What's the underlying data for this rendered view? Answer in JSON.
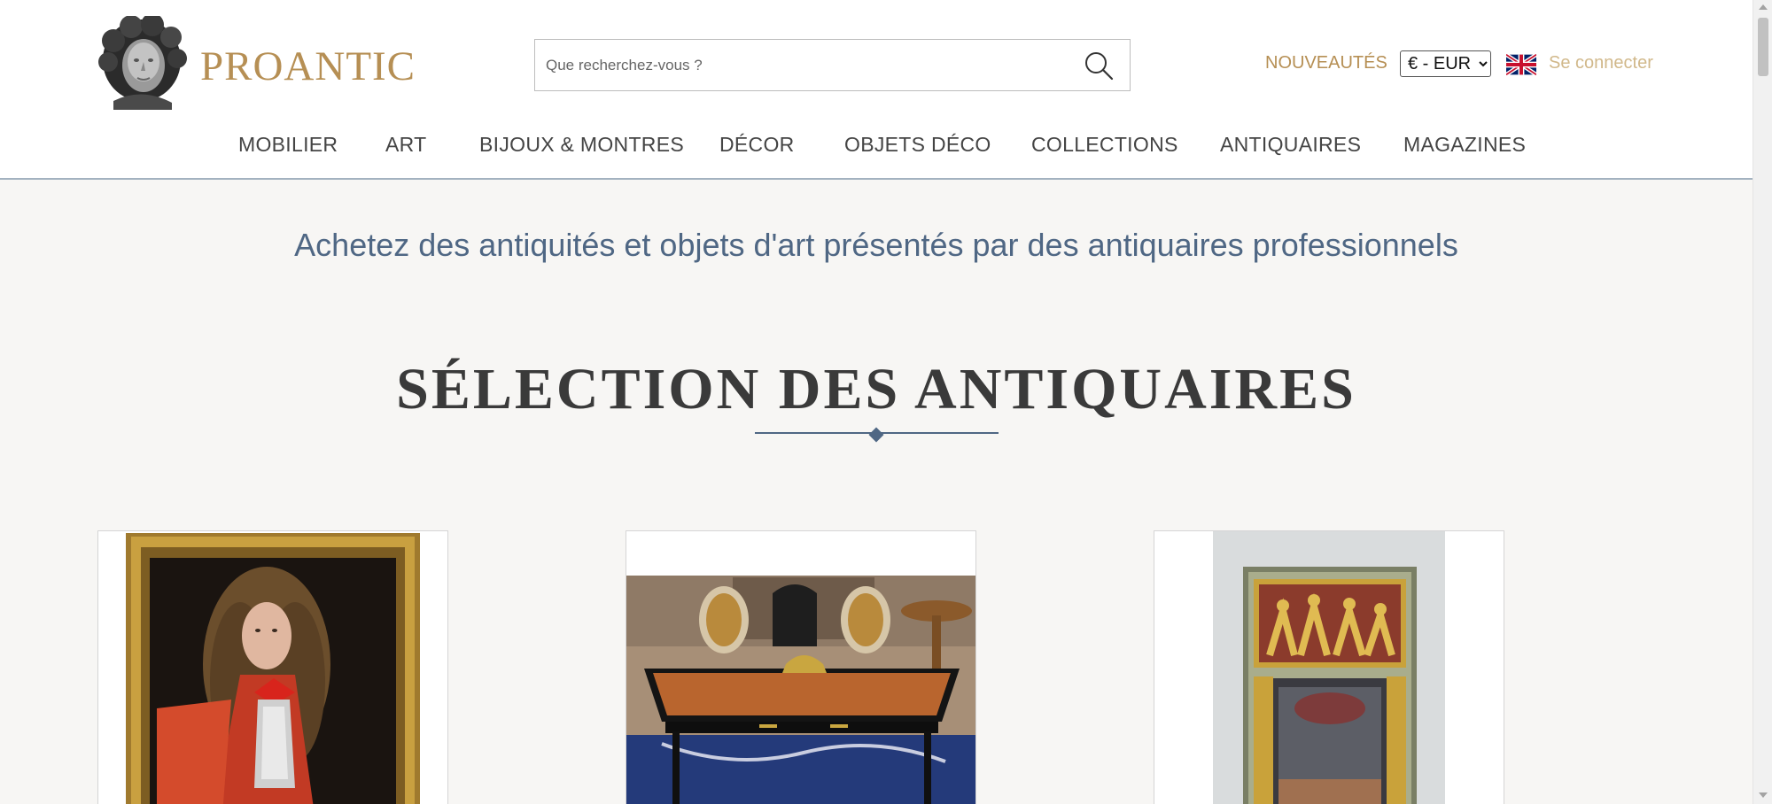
{
  "header": {
    "logo_text": "PROANTIC",
    "search": {
      "placeholder": "Que recherchez-vous ?",
      "value": ""
    },
    "nouveautes_label": "NOUVEAUTÉS",
    "currency": {
      "selected": "€ - EUR",
      "options": [
        "€ - EUR"
      ]
    },
    "language_flag": "uk-flag-icon",
    "login_label": "Se connecter"
  },
  "nav": {
    "items": [
      {
        "label": "MOBILIER"
      },
      {
        "label": "ART"
      },
      {
        "label": "BIJOUX & MONTRES"
      },
      {
        "label": "DÉCOR"
      },
      {
        "label": "OBJETS DÉCO"
      },
      {
        "label": "COLLECTIONS"
      },
      {
        "label": "ANTIQUAIRES"
      },
      {
        "label": "MAGAZINES"
      }
    ]
  },
  "main": {
    "tagline": "Achetez des antiquités et objets d'art présentés par des antiquaires professionnels",
    "section_title": "SÉLECTION DES ANTIQUAIRES",
    "cards": [
      {
        "image": "portrait-painting-gilt-frame"
      },
      {
        "image": "desk-with-chairs"
      },
      {
        "image": "trumeau-mirror"
      }
    ]
  },
  "colors": {
    "brand_gold": "#b68f54",
    "login_gold": "#d1b88a",
    "accent_blue": "#4f6784",
    "page_bg": "#f7f6f4"
  }
}
